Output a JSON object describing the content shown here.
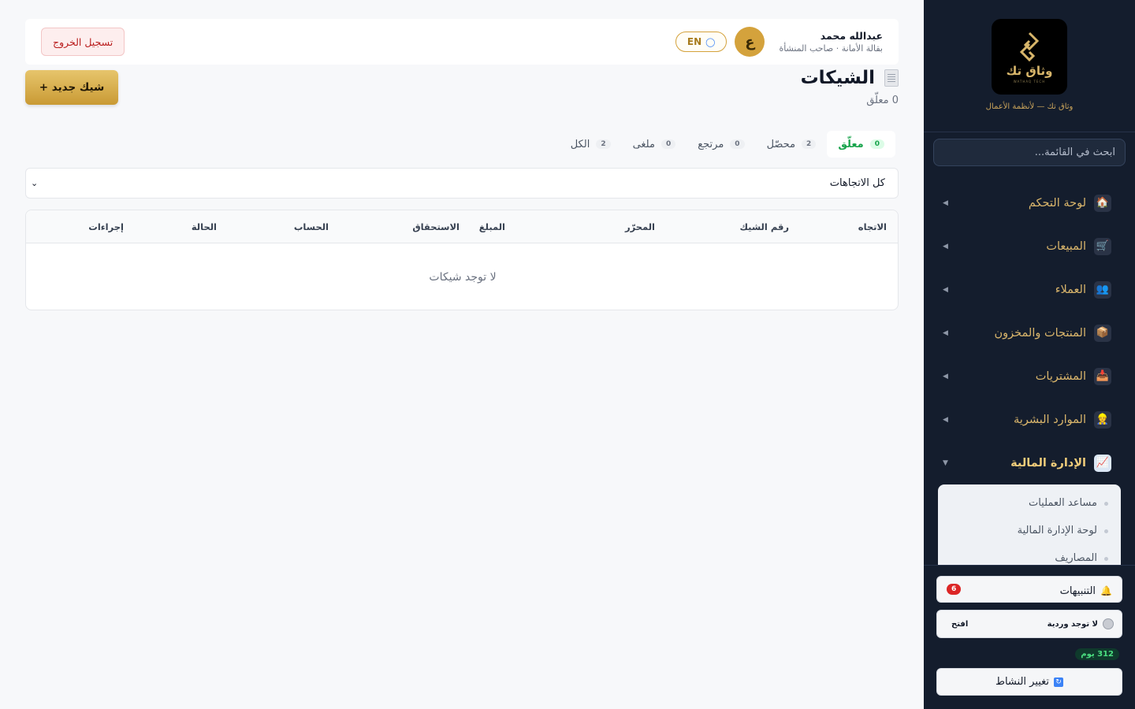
{
  "sidebar": {
    "brand_name": "وثاق تك",
    "brand_sub": "WATHAQ TECH",
    "brand_tagline": "وثاق تك — لأنظمة الأعمال",
    "search_placeholder": "ابحث في القائمة...",
    "nav": [
      {
        "label": "لوحة التحكم",
        "icon": "house-icon"
      },
      {
        "label": "المبيعات",
        "icon": "cart-icon"
      },
      {
        "label": "العملاء",
        "icon": "users-icon"
      },
      {
        "label": "المنتجات والمخزون",
        "icon": "package-icon"
      },
      {
        "label": "المشتريات",
        "icon": "inbox-icon"
      },
      {
        "label": "الموارد البشرية",
        "icon": "person-icon"
      },
      {
        "label": "الإدارة المالية",
        "icon": "chart-icon"
      }
    ],
    "submenu": [
      "مساعد العمليات",
      "لوحة الإدارة المالية",
      "المصاريف"
    ],
    "alerts_label": "التنبيهات",
    "alerts_count": "6",
    "shift_status": "لا توجد وردية",
    "open_label": "افتح",
    "days_badge": "312 يوم",
    "change_activity": "تغيير النشاط"
  },
  "topbar": {
    "logout": "تسجيل الخروج",
    "user_name": "عبدالله محمد",
    "user_role": "بقالة الأمانة · صاحب المنشأة",
    "avatar_letter": "ع",
    "lang": "EN"
  },
  "page": {
    "title": "الشيكات",
    "subtitle": "0 معلّق",
    "new_button": "+ شيك جديد"
  },
  "tabs": [
    {
      "label": "معلّق",
      "count": "0"
    },
    {
      "label": "محصّل",
      "count": "2"
    },
    {
      "label": "مرتجع",
      "count": "0"
    },
    {
      "label": "ملغى",
      "count": "0"
    },
    {
      "label": "الكل",
      "count": "2"
    }
  ],
  "filter": {
    "value": "كل الاتجاهات"
  },
  "table": {
    "columns": [
      "الاتجاه",
      "رقم الشيك",
      "المحرّر",
      "المبلغ",
      "الاستحقاق",
      "الحساب",
      "الحالة",
      "إجراءات"
    ],
    "empty_text": "لا توجد شيكات"
  },
  "colors": {
    "sidebar_bg": "#141d2d",
    "gold": "#d4a23c",
    "active_tab": "#16a34a",
    "danger": "#dc2626"
  }
}
